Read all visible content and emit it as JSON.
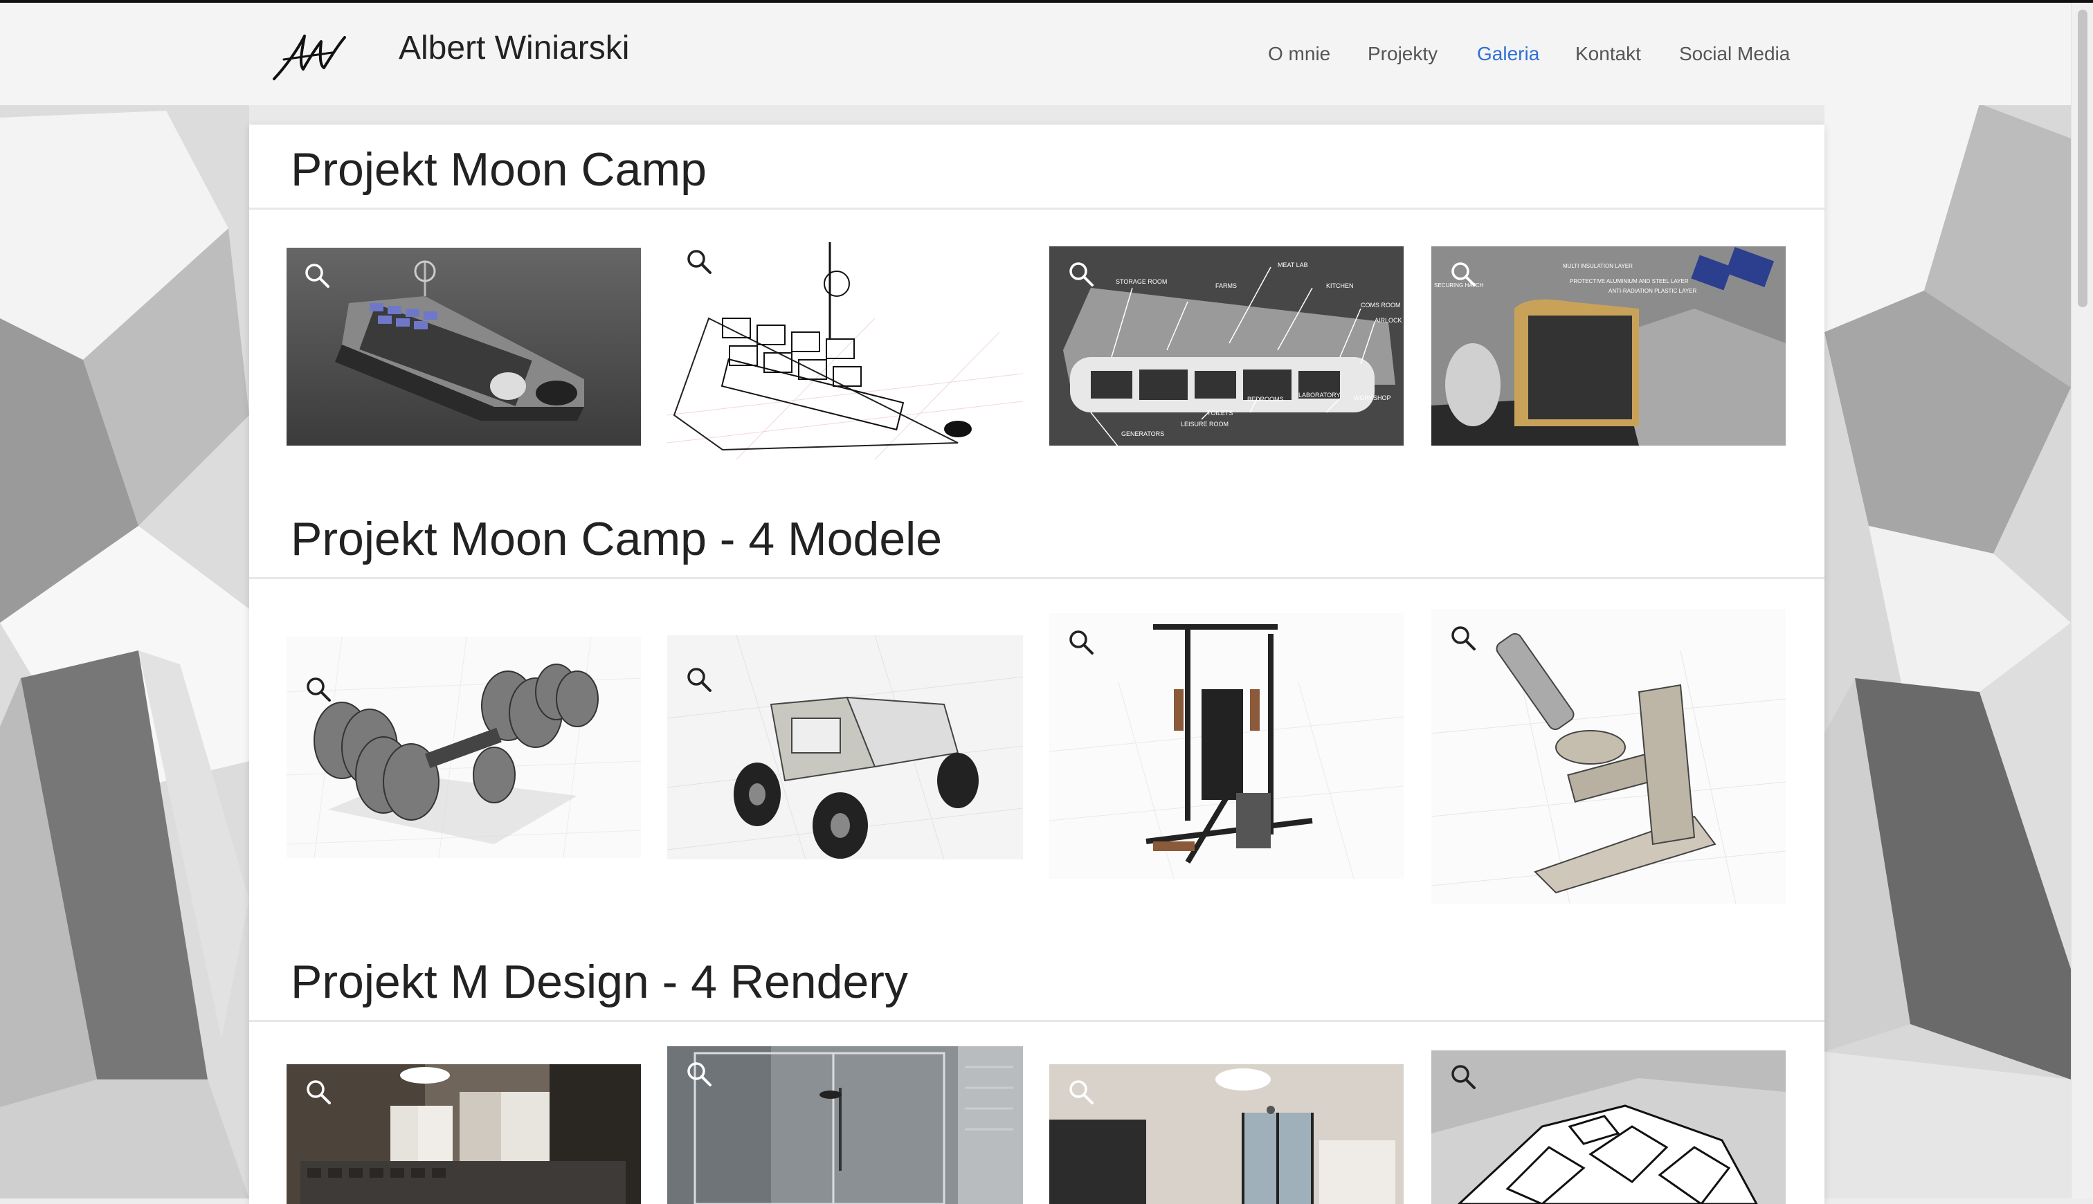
{
  "brand": {
    "name": "Albert Winiarski",
    "logo": "signature-logo"
  },
  "nav": {
    "items": [
      {
        "label": "O mnie",
        "active": false
      },
      {
        "label": "Projekty",
        "active": false
      },
      {
        "label": "Galeria",
        "active": true
      },
      {
        "label": "Kontakt",
        "active": false
      },
      {
        "label": "Social Media",
        "active": false
      }
    ]
  },
  "colors": {
    "accent": "#2f6fd6",
    "text": "#222222",
    "nav_text": "#555555"
  },
  "sections": [
    {
      "title": "Projekt Moon Camp",
      "images": [
        {
          "name": "moon-camp-render-dark",
          "icon": "magnifier-icon"
        },
        {
          "name": "moon-camp-wireframe",
          "icon": "magnifier-icon"
        },
        {
          "name": "moon-camp-cutaway-labeled",
          "icon": "magnifier-icon"
        },
        {
          "name": "moon-camp-section-labeled",
          "icon": "magnifier-icon"
        }
      ],
      "cutaway_labels": [
        "STORAGE ROOM",
        "FARMS",
        "MEAT LAB",
        "KITCHEN",
        "COMS ROOM",
        "AIRLOCK",
        "WORKSHOP",
        "LABORATORY",
        "BEDROOMS",
        "TOILETS",
        "LEISURE ROOM",
        "GENERATORS"
      ],
      "section_labels": [
        "MULTI INSULATION LAYER",
        "PROTECTIVE ALUMINIUM AND STEEL LAYER",
        "ANTI-RADIATION PLASTIC LAYER",
        "SECURING HATCH"
      ]
    },
    {
      "title": "Projekt Moon Camp - 4 Modele",
      "images": [
        {
          "name": "model-dumbbells",
          "icon": "magnifier-icon"
        },
        {
          "name": "model-rover",
          "icon": "magnifier-icon"
        },
        {
          "name": "model-gym-machine",
          "icon": "magnifier-icon"
        },
        {
          "name": "model-microscope",
          "icon": "magnifier-icon"
        }
      ]
    },
    {
      "title": "Projekt M Design - 4 Rendery",
      "images": [
        {
          "name": "render-kitchen",
          "icon": "magnifier-icon"
        },
        {
          "name": "render-shower",
          "icon": "magnifier-icon"
        },
        {
          "name": "render-living-room",
          "icon": "magnifier-icon"
        },
        {
          "name": "render-floor-plan",
          "icon": "magnifier-icon"
        }
      ]
    }
  ]
}
